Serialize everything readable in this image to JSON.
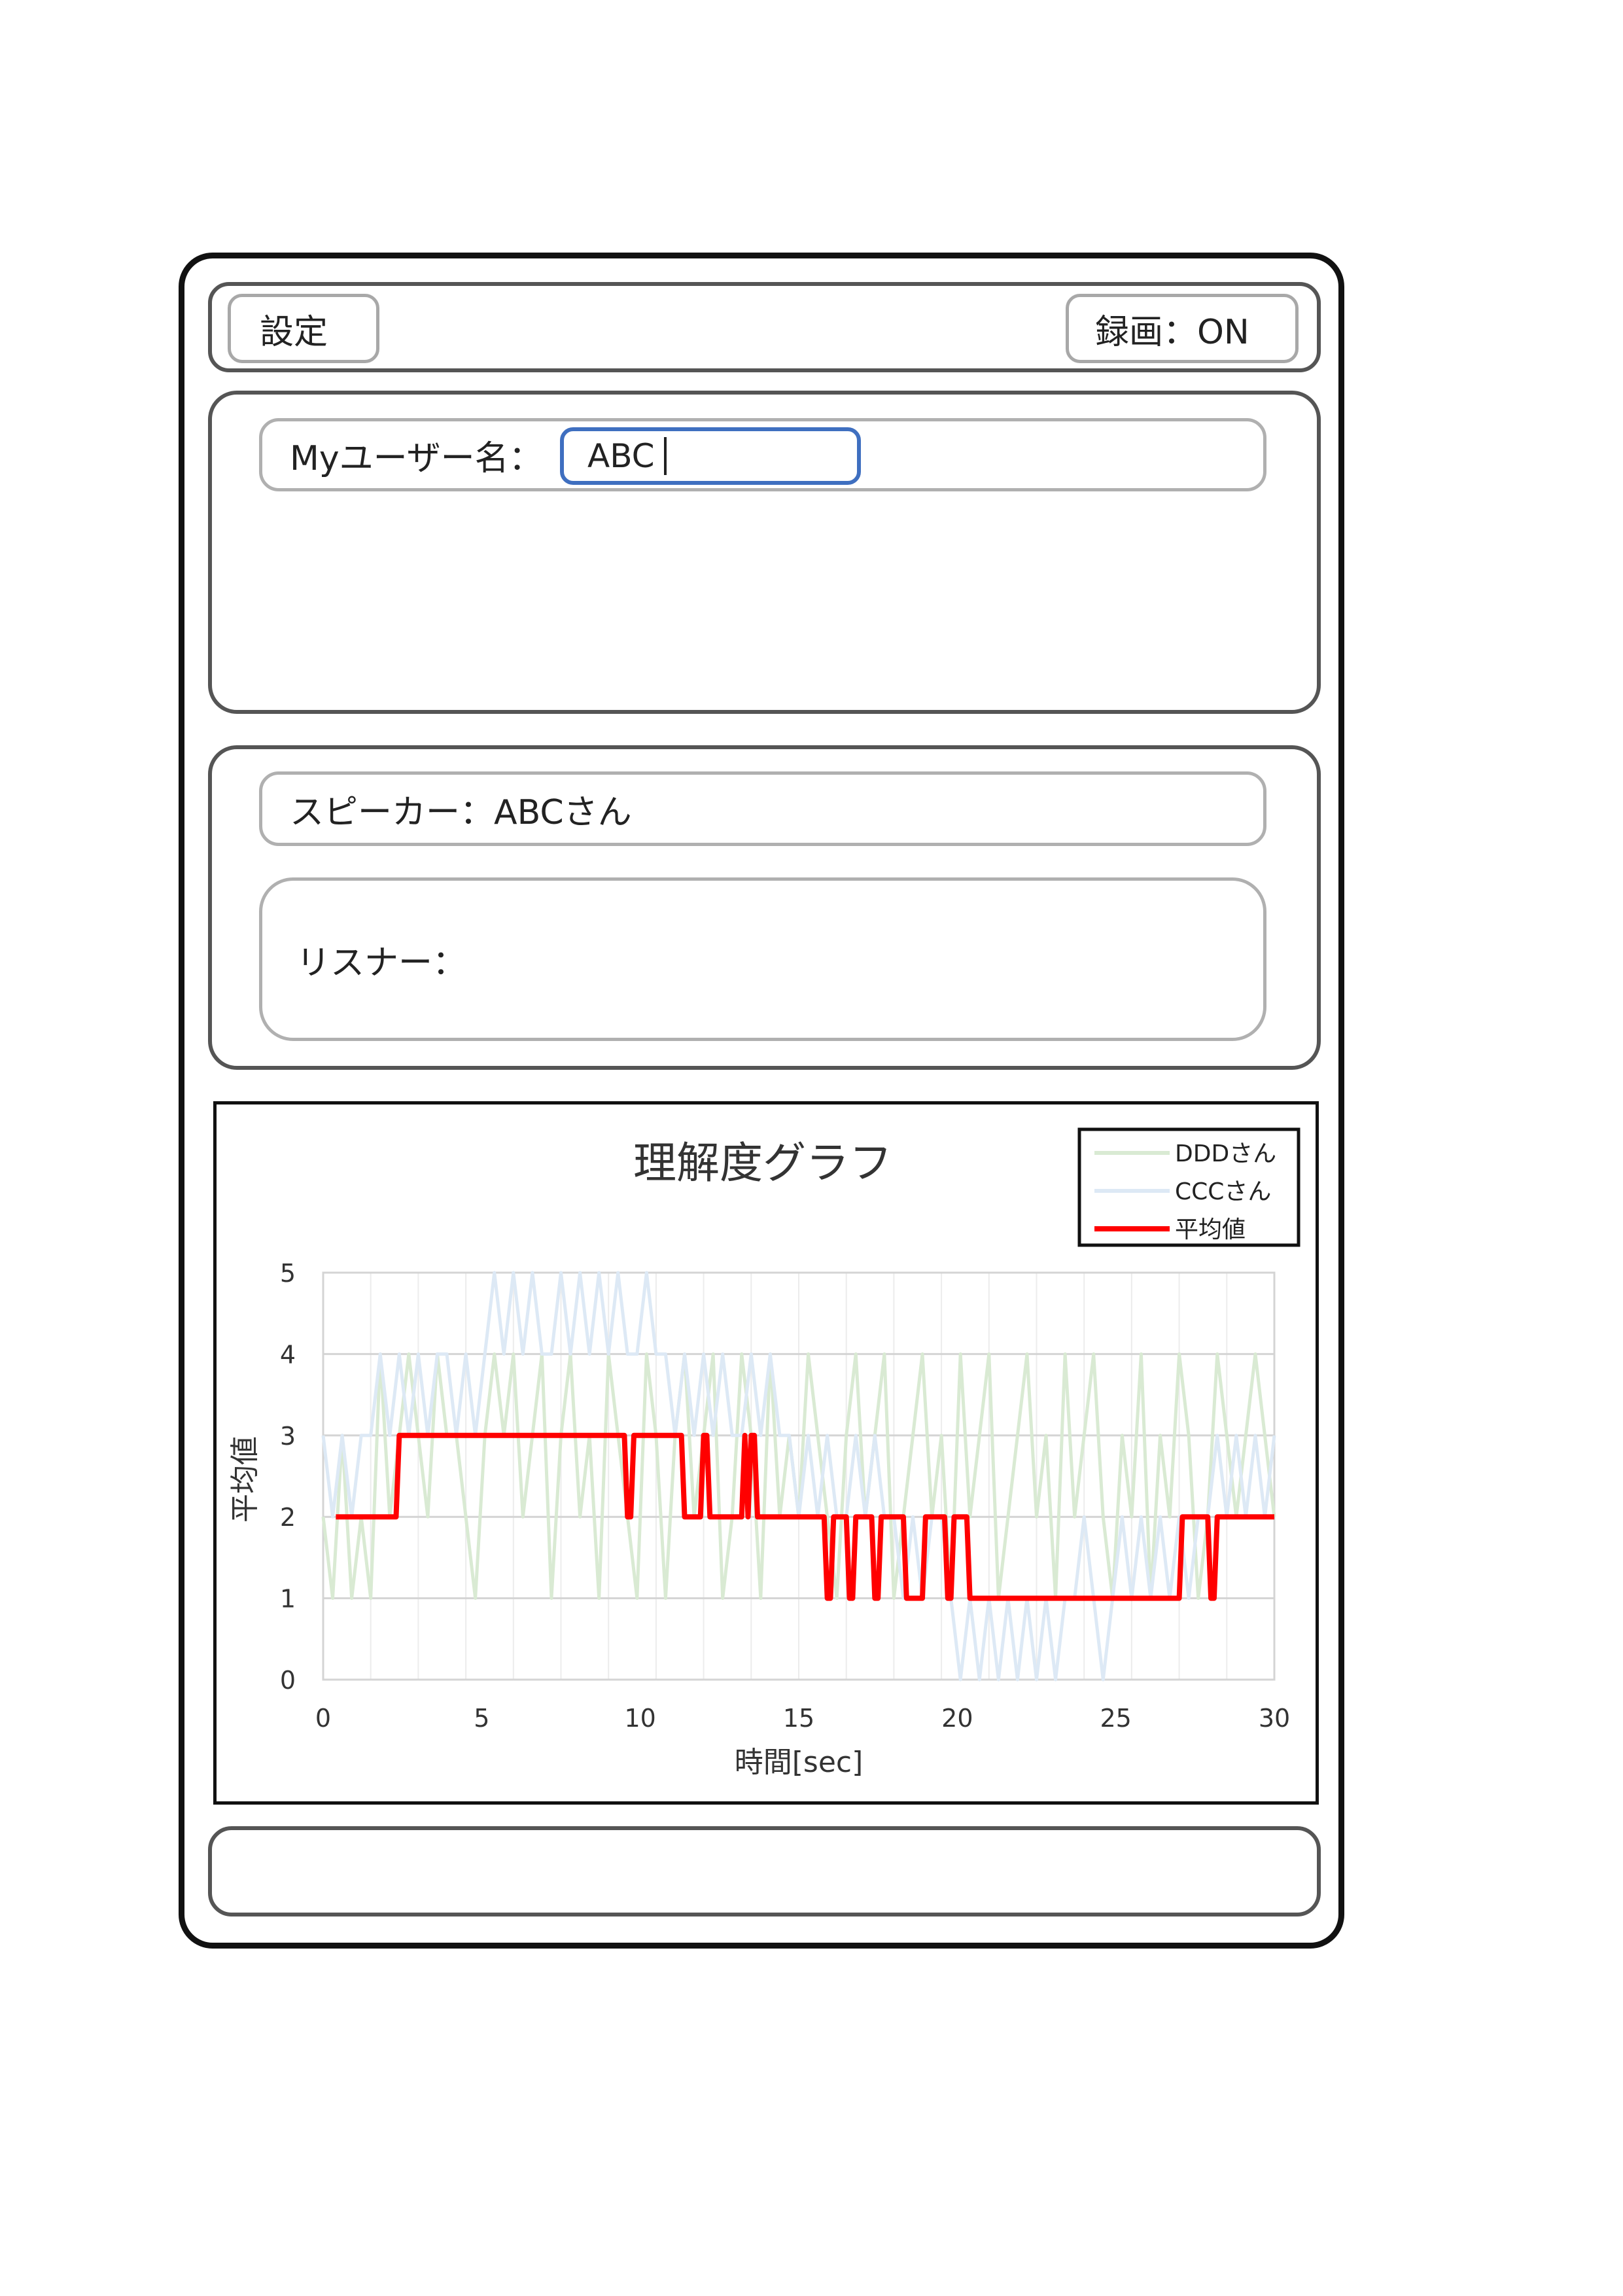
{
  "header": {
    "settings_label": "設定",
    "recording_label": "録画：ON"
  },
  "user": {
    "label": "Myユーザー名：",
    "value": "ABC"
  },
  "session": {
    "speaker_label": "スピーカー：ABCさん",
    "listener_label": "リスナー："
  },
  "colors": {
    "accent_input_border": "#3f6fc0",
    "average_line": "#ff0000",
    "ddd_line": "#d9ead3",
    "ccc_line": "#dde9f5"
  },
  "chart_data": {
    "type": "line",
    "title": "理解度グラフ",
    "xlabel": "時間[sec]",
    "ylabel": "平均値",
    "xlim": [
      0,
      30
    ],
    "ylim": [
      0,
      5
    ],
    "xticks": [
      0,
      5,
      10,
      15,
      20,
      25,
      30
    ],
    "yticks": [
      0,
      1,
      2,
      3,
      4,
      5
    ],
    "grid": true,
    "legend_position": "top-right",
    "series": [
      {
        "name": "DDDさん",
        "color": "#d9ead3",
        "x": [
          0,
          0.3,
          0.6,
          0.9,
          1.2,
          1.5,
          1.8,
          2.1,
          2.4,
          2.7,
          3.0,
          3.3,
          3.6,
          3.9,
          4.2,
          4.5,
          4.8,
          5.1,
          5.4,
          5.7,
          6.0,
          6.3,
          6.6,
          6.9,
          7.2,
          7.5,
          7.8,
          8.1,
          8.4,
          8.7,
          9.0,
          9.3,
          9.6,
          9.9,
          10.2,
          10.5,
          10.8,
          11.1,
          11.4,
          11.7,
          12.0,
          12.3,
          12.6,
          12.9,
          13.2,
          13.5,
          13.8,
          14.1,
          14.4,
          14.7,
          15.0,
          15.3,
          15.6,
          15.9,
          16.2,
          16.5,
          16.8,
          17.1,
          17.4,
          17.7,
          18.0,
          18.3,
          18.6,
          18.9,
          19.2,
          19.5,
          19.8,
          20.1,
          20.4,
          20.7,
          21.0,
          21.3,
          21.6,
          21.9,
          22.2,
          22.5,
          22.8,
          23.1,
          23.4,
          23.7,
          24.0,
          24.3,
          24.6,
          24.9,
          25.2,
          25.5,
          25.8,
          26.1,
          26.4,
          26.7,
          27.0,
          27.3,
          27.6,
          27.9,
          28.2,
          28.5,
          28.8,
          29.1,
          29.4,
          29.7,
          30.0
        ],
        "values": [
          2,
          1,
          3,
          1,
          2,
          1,
          4,
          2,
          3,
          4,
          3,
          2,
          4,
          3,
          3,
          2,
          1,
          3,
          4,
          3,
          4,
          2,
          3,
          4,
          1,
          3,
          4,
          2,
          3,
          1,
          4,
          3,
          2,
          1,
          4,
          3,
          1,
          3,
          4,
          2,
          3,
          4,
          1,
          2,
          4,
          3,
          1,
          4,
          2,
          3,
          2,
          4,
          3,
          2,
          1,
          3,
          4,
          2,
          3,
          4,
          1,
          2,
          3,
          4,
          2,
          3,
          1,
          4,
          2,
          3,
          4,
          1,
          2,
          3,
          4,
          2,
          3,
          1,
          4,
          2,
          3,
          4,
          2,
          1,
          3,
          2,
          4,
          1,
          3,
          2,
          4,
          3,
          1,
          2,
          4,
          3,
          2,
          3,
          4,
          3,
          2
        ]
      },
      {
        "name": "CCCさん",
        "color": "#dde9f5",
        "x": [
          0,
          0.3,
          0.6,
          0.9,
          1.2,
          1.5,
          1.8,
          2.1,
          2.4,
          2.7,
          3.0,
          3.3,
          3.6,
          3.9,
          4.2,
          4.5,
          4.8,
          5.1,
          5.4,
          5.7,
          6.0,
          6.3,
          6.6,
          6.9,
          7.2,
          7.5,
          7.8,
          8.1,
          8.4,
          8.7,
          9.0,
          9.3,
          9.6,
          9.9,
          10.2,
          10.5,
          10.8,
          11.1,
          11.4,
          11.7,
          12.0,
          12.3,
          12.6,
          12.9,
          13.2,
          13.5,
          13.8,
          14.1,
          14.4,
          14.7,
          15.0,
          15.3,
          15.6,
          15.9,
          16.2,
          16.5,
          16.8,
          17.1,
          17.4,
          17.7,
          18.0,
          18.3,
          18.6,
          18.9,
          19.2,
          19.5,
          19.8,
          20.1,
          20.4,
          20.7,
          21.0,
          21.3,
          21.6,
          21.9,
          22.2,
          22.5,
          22.8,
          23.1,
          23.4,
          23.7,
          24.0,
          24.3,
          24.6,
          24.9,
          25.2,
          25.5,
          25.8,
          26.1,
          26.4,
          26.7,
          27.0,
          27.3,
          27.6,
          27.9,
          28.2,
          28.5,
          28.8,
          29.1,
          29.4,
          29.7,
          30.0
        ],
        "values": [
          3,
          2,
          3,
          2,
          3,
          3,
          4,
          3,
          4,
          3,
          4,
          3,
          4,
          4,
          3,
          4,
          3,
          4,
          5,
          4,
          5,
          4,
          5,
          4,
          4,
          5,
          4,
          5,
          4,
          5,
          4,
          5,
          4,
          4,
          5,
          4,
          4,
          3,
          4,
          3,
          4,
          3,
          4,
          3,
          3,
          4,
          3,
          4,
          3,
          3,
          2,
          3,
          2,
          3,
          2,
          2,
          3,
          2,
          3,
          2,
          2,
          1,
          2,
          1,
          2,
          2,
          1,
          0,
          1,
          0,
          1,
          0,
          1,
          0,
          1,
          0,
          1,
          0,
          1,
          1,
          2,
          1,
          0,
          1,
          2,
          1,
          2,
          1,
          2,
          1,
          2,
          1,
          2,
          2,
          3,
          2,
          3,
          2,
          3,
          2,
          3
        ]
      },
      {
        "name": "平均値",
        "color": "#ff0000",
        "x": [
          0.4,
          2.3,
          2.4,
          9.5,
          9.6,
          9.7,
          9.8,
          11.3,
          11.4,
          11.9,
          12.0,
          12.1,
          12.2,
          13.2,
          13.3,
          13.4,
          13.5,
          13.6,
          13.7,
          15.8,
          15.9,
          16.0,
          16.1,
          16.5,
          16.6,
          16.7,
          16.8,
          17.3,
          17.4,
          17.5,
          17.6,
          18.3,
          18.4,
          18.9,
          19.0,
          19.6,
          19.7,
          19.8,
          19.9,
          20.3,
          20.4,
          27.0,
          27.1,
          27.9,
          28.0,
          28.1,
          28.2,
          30.0
        ],
        "values": [
          2,
          2,
          3,
          3,
          2,
          2,
          3,
          3,
          2,
          2,
          3,
          3,
          2,
          2,
          3,
          2,
          3,
          3,
          2,
          2,
          1,
          1,
          2,
          2,
          1,
          1,
          2,
          2,
          1,
          1,
          2,
          2,
          1,
          1,
          2,
          2,
          1,
          1,
          2,
          2,
          1,
          1,
          2,
          2,
          1,
          1,
          2,
          2
        ]
      }
    ]
  }
}
